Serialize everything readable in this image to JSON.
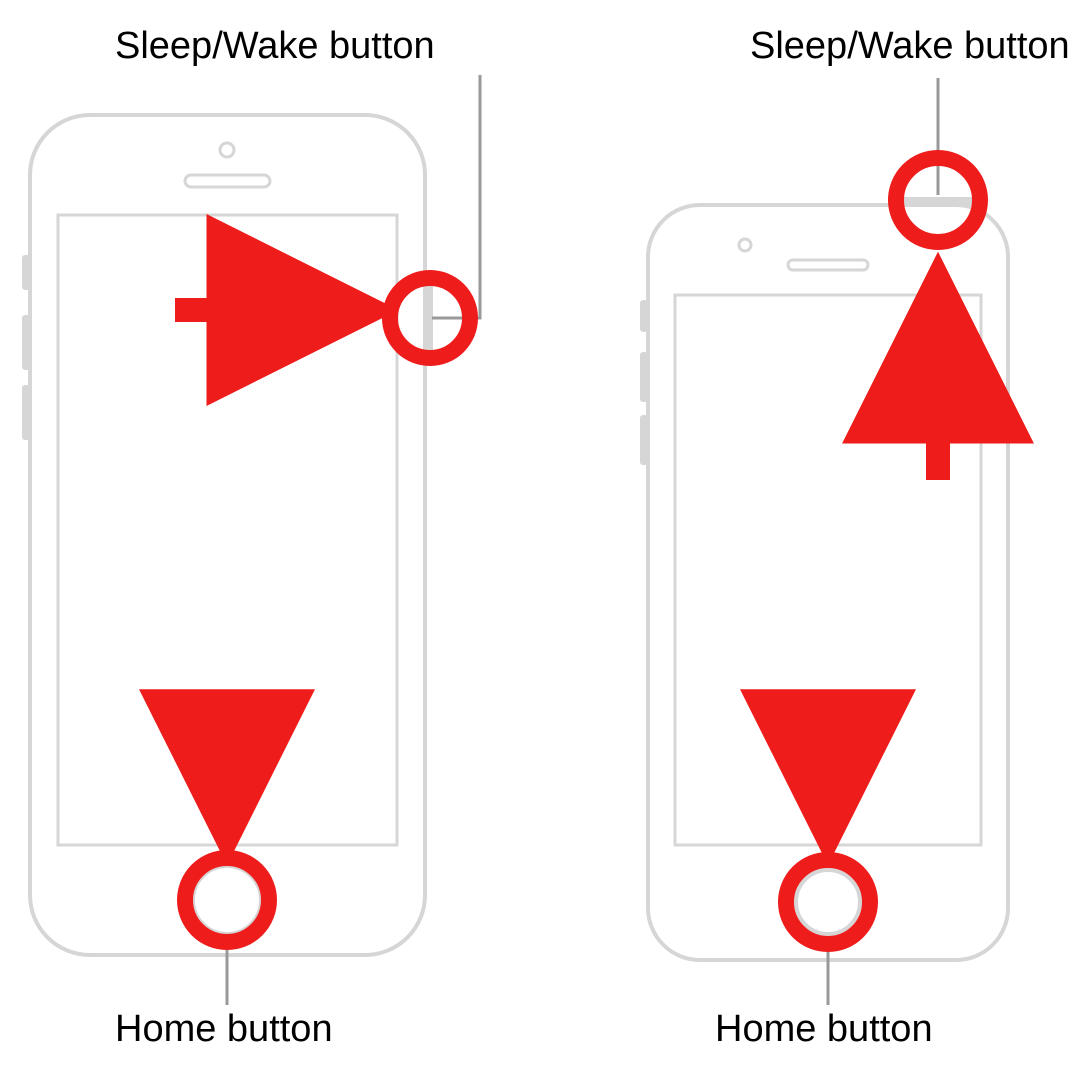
{
  "colors": {
    "accent": "#ef1c1c",
    "outline": "#d6d6d6",
    "thin": "#999999"
  },
  "left": {
    "sleep_label": "Sleep/Wake button",
    "home_label": "Home button"
  },
  "right": {
    "sleep_label": "Sleep/Wake button",
    "home_label": "Home button"
  }
}
